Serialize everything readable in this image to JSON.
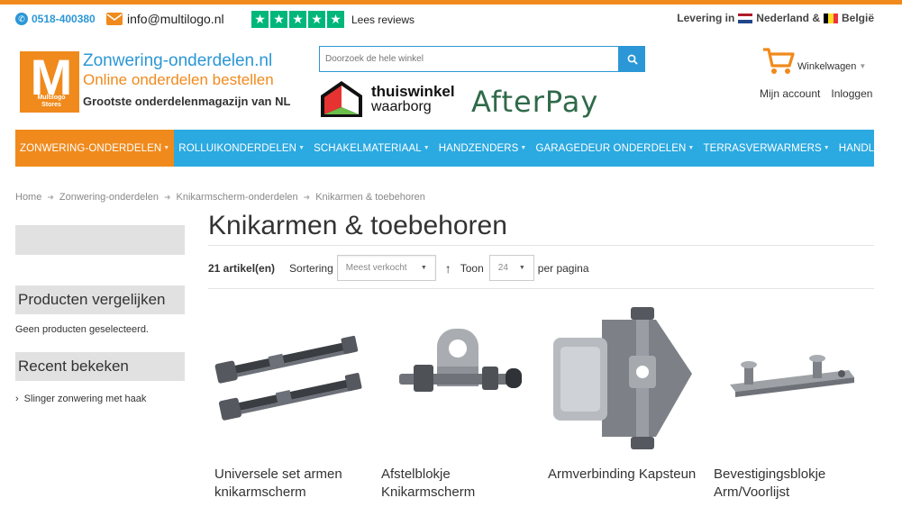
{
  "topbar": {
    "phone": "0518-400380",
    "email": "info@multilogo.nl",
    "reviews_label": "Lees reviews",
    "delivery_prefix": "Levering in",
    "delivery_nl": "Nederland &",
    "delivery_be": "België",
    "colors": {
      "accent_orange": "#f08a1c",
      "accent_blue": "#2b97d6",
      "trustpilot_green": "#00b67a"
    }
  },
  "logo": {
    "letter": "M",
    "sub1": "Multilogo",
    "sub2": "Stores",
    "line1": "Zonwering-onderdelen.nl",
    "line2": "Online onderdelen bestellen",
    "line3": "Grootste onderdelenmagazijn van NL"
  },
  "search": {
    "placeholder": "Doorzoek de hele winkel",
    "icon": "search-icon"
  },
  "badges": {
    "thuiswinkel_1": "thuiswinkel",
    "thuiswinkel_2": "waarborg",
    "afterpay": "AfterPay"
  },
  "header": {
    "cart_label": "Winkelwagen",
    "account_label": "Mijn account",
    "login_label": "Inloggen"
  },
  "nav": {
    "items": [
      {
        "label": "ZONWERING-ONDERDELEN"
      },
      {
        "label": "ROLLUIKONDERDELEN"
      },
      {
        "label": "SCHAKELMATERIAAL"
      },
      {
        "label": "HANDZENDERS"
      },
      {
        "label": "GARAGEDEUR ONDERDELEN"
      },
      {
        "label": "TERRASVERWARMERS"
      },
      {
        "label": "HANDLEIDINGEN"
      }
    ],
    "colors": {
      "bar": "#2ba9e1",
      "active": "#f08a1c"
    }
  },
  "breadcrumb": {
    "items": [
      "Home",
      "Zonwering-onderdelen",
      "Knikarmscherm-onderdelen",
      "Knikarmen & toebehoren"
    ]
  },
  "main": {
    "title": "Knikarmen & toebehoren",
    "count": "21 artikel(en)",
    "sort_label": "Sortering",
    "sort_value": "Meest verkocht",
    "show_label": "Toon",
    "show_value": "24",
    "per_page": "per pagina"
  },
  "sidebar": {
    "compare_title": "Producten vergelijken",
    "compare_empty": "Geen producten geselecteerd.",
    "recent_title": "Recent bekeken",
    "recent_items": [
      "Slinger zonwering met haak"
    ]
  },
  "products": [
    {
      "name": "Universele set armen knikarmscherm"
    },
    {
      "name": "Afstelblokje Knikarmscherm"
    },
    {
      "name": "Armverbinding Kapsteun"
    },
    {
      "name": "Bevestigingsblokje Arm/Voorlijst"
    }
  ]
}
